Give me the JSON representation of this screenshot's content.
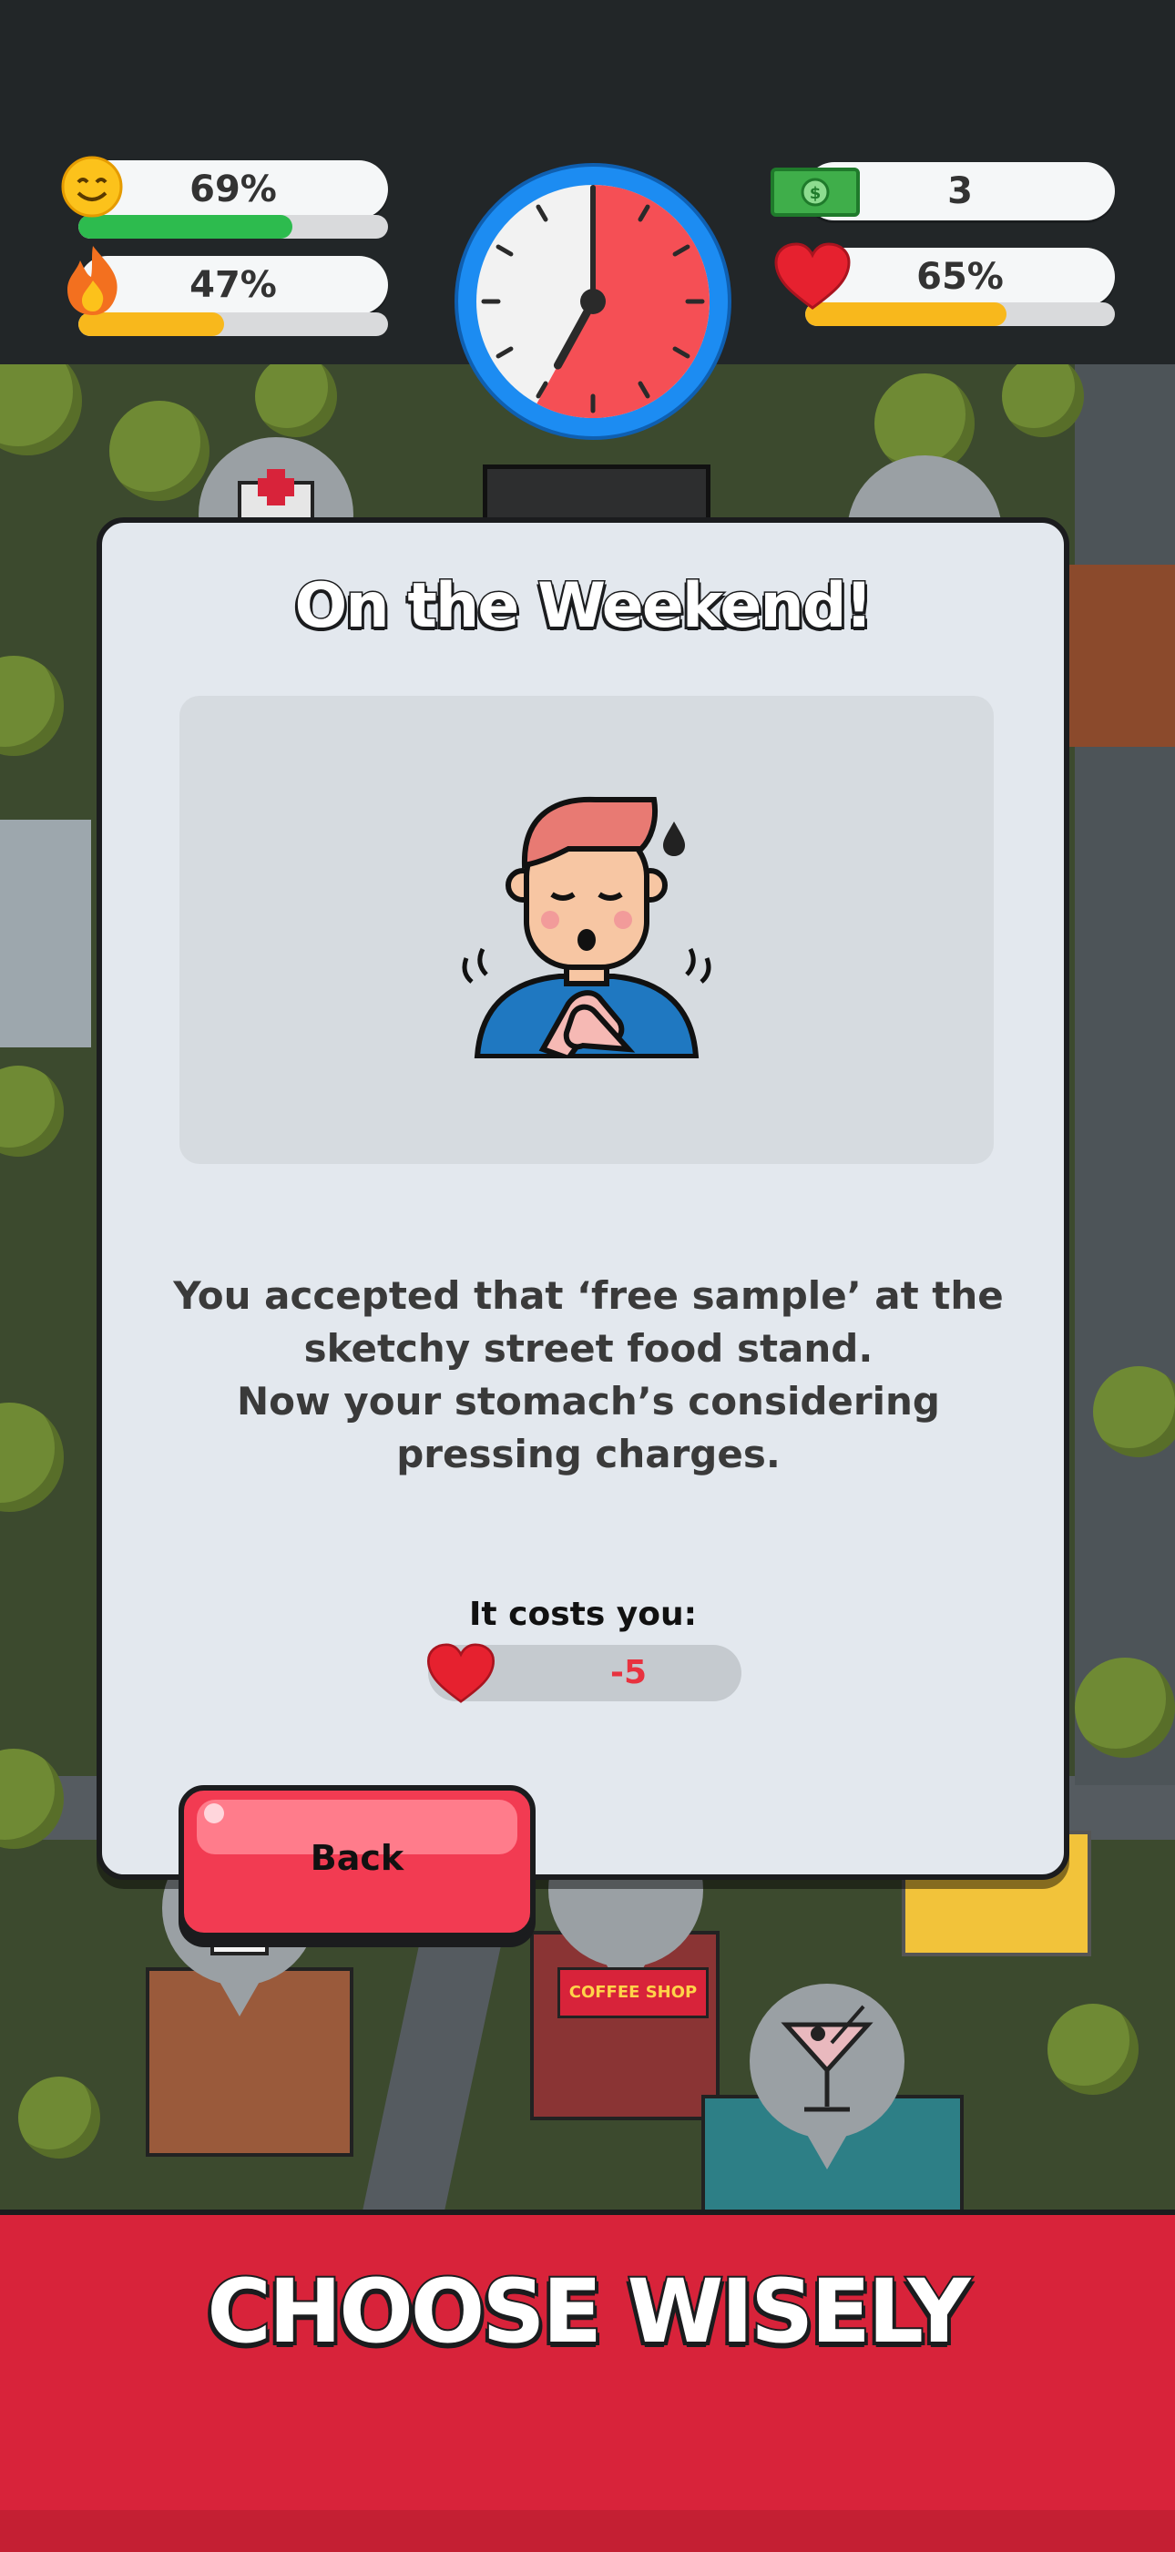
{
  "hud": {
    "happiness": {
      "icon": "smiley-face-icon",
      "label": "69%",
      "value": 0.69,
      "color": "#2dbb4e"
    },
    "energy": {
      "icon": "flame-icon",
      "label": "47%",
      "value": 0.47,
      "color": "#f8b81c"
    },
    "timer": {
      "icon": "clock-timer-icon",
      "elapsed_fraction": 0.58
    },
    "money": {
      "icon": "dollar-bill-icon",
      "label": "3"
    },
    "health": {
      "icon": "heart-icon",
      "label": "65%",
      "value": 0.65,
      "color": "#f8b81c"
    }
  },
  "modal": {
    "title": "On the Weekend!",
    "illustration": "sick-man-icon",
    "story_lines": [
      "You accepted that ‘free sample’ at the",
      "sketchy street food stand.",
      "Now your stomach’s considering",
      "pressing charges."
    ],
    "cost_label": "It costs you:",
    "cost_icon": "heart-icon",
    "cost_value": "-5",
    "back_label": "Back"
  },
  "map": {
    "pins": [
      "hospital-icon",
      "house-icon",
      "cocktail-icon"
    ],
    "sign_text": "COFFEE SHOP"
  },
  "banner": {
    "text": "CHOOSE WISELY"
  },
  "colors": {
    "accent_red": "#d8233a",
    "button_red": "#f23b52",
    "clock_blue": "#1c8cf2"
  }
}
